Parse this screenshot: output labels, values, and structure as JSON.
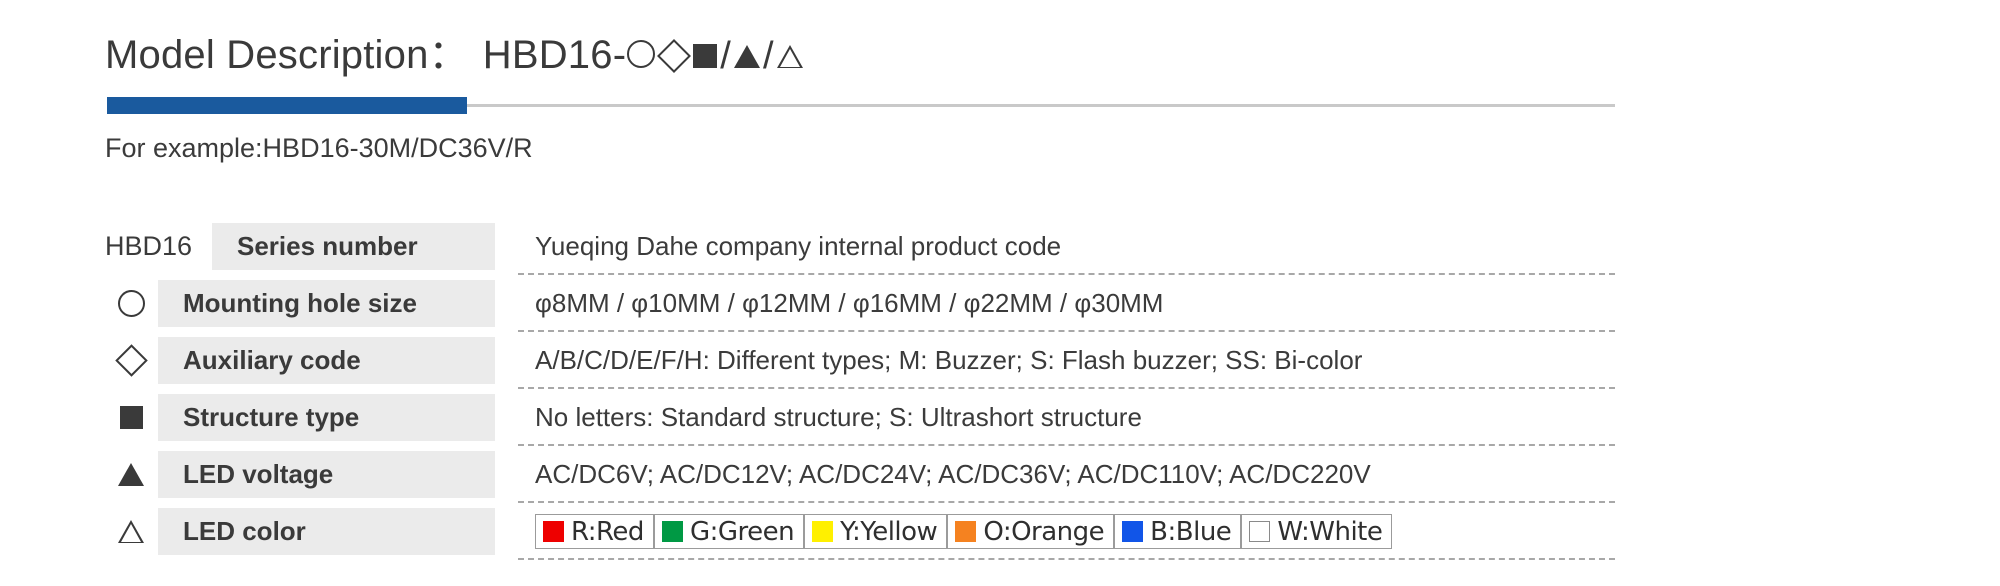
{
  "header": {
    "title_label": "Model Description：",
    "model_prefix": "HBD16-",
    "model_symbols": [
      "circle-outline",
      "diamond-outline",
      "square-filled",
      "triangle-filled",
      "triangle-outline"
    ],
    "accent_color": "#1a5a9e",
    "rule_color": "#c9c9c9",
    "example": "For example:HBD16-30M/DC36V/R"
  },
  "table": {
    "rows": [
      {
        "symbol": "HBD16",
        "symbol_kind": "text",
        "label": "Series number",
        "description": "Yueqing Dahe company internal product code"
      },
      {
        "symbol": "○",
        "symbol_kind": "circle-outline",
        "label": "Mounting hole size",
        "description": "φ8MM / φ10MM / φ12MM / φ16MM / φ22MM / φ30MM"
      },
      {
        "symbol": "◇",
        "symbol_kind": "diamond-outline",
        "label": "Auxiliary code",
        "description": "A/B/C/D/E/F/H: Different types;   M: Buzzer;   S: Flash buzzer;   SS: Bi-color"
      },
      {
        "symbol": "■",
        "symbol_kind": "square-filled",
        "label": "Structure type",
        "description": "No letters: Standard structure;   S: Ultrashort structure"
      },
      {
        "symbol": "▲",
        "symbol_kind": "triangle-filled",
        "label": "LED voltage",
        "description": "AC/DC6V;   AC/DC12V;   AC/DC24V;   AC/DC36V;   AC/DC110V;   AC/DC220V"
      },
      {
        "symbol": "△",
        "symbol_kind": "triangle-outline",
        "label": "LED color",
        "description": ""
      }
    ],
    "label_background": "#ebebeb",
    "divider_style": "dashed"
  },
  "led_colors": [
    {
      "label": "R:Red",
      "color": "#ee0000"
    },
    {
      "label": "G:Green",
      "color": "#009944"
    },
    {
      "label": "Y:Yellow",
      "color": "#fff000"
    },
    {
      "label": "O:Orange",
      "color": "#f58220"
    },
    {
      "label": "B:Blue",
      "color": "#1155e8"
    },
    {
      "label": "W:White",
      "color": "#ffffff"
    }
  ]
}
